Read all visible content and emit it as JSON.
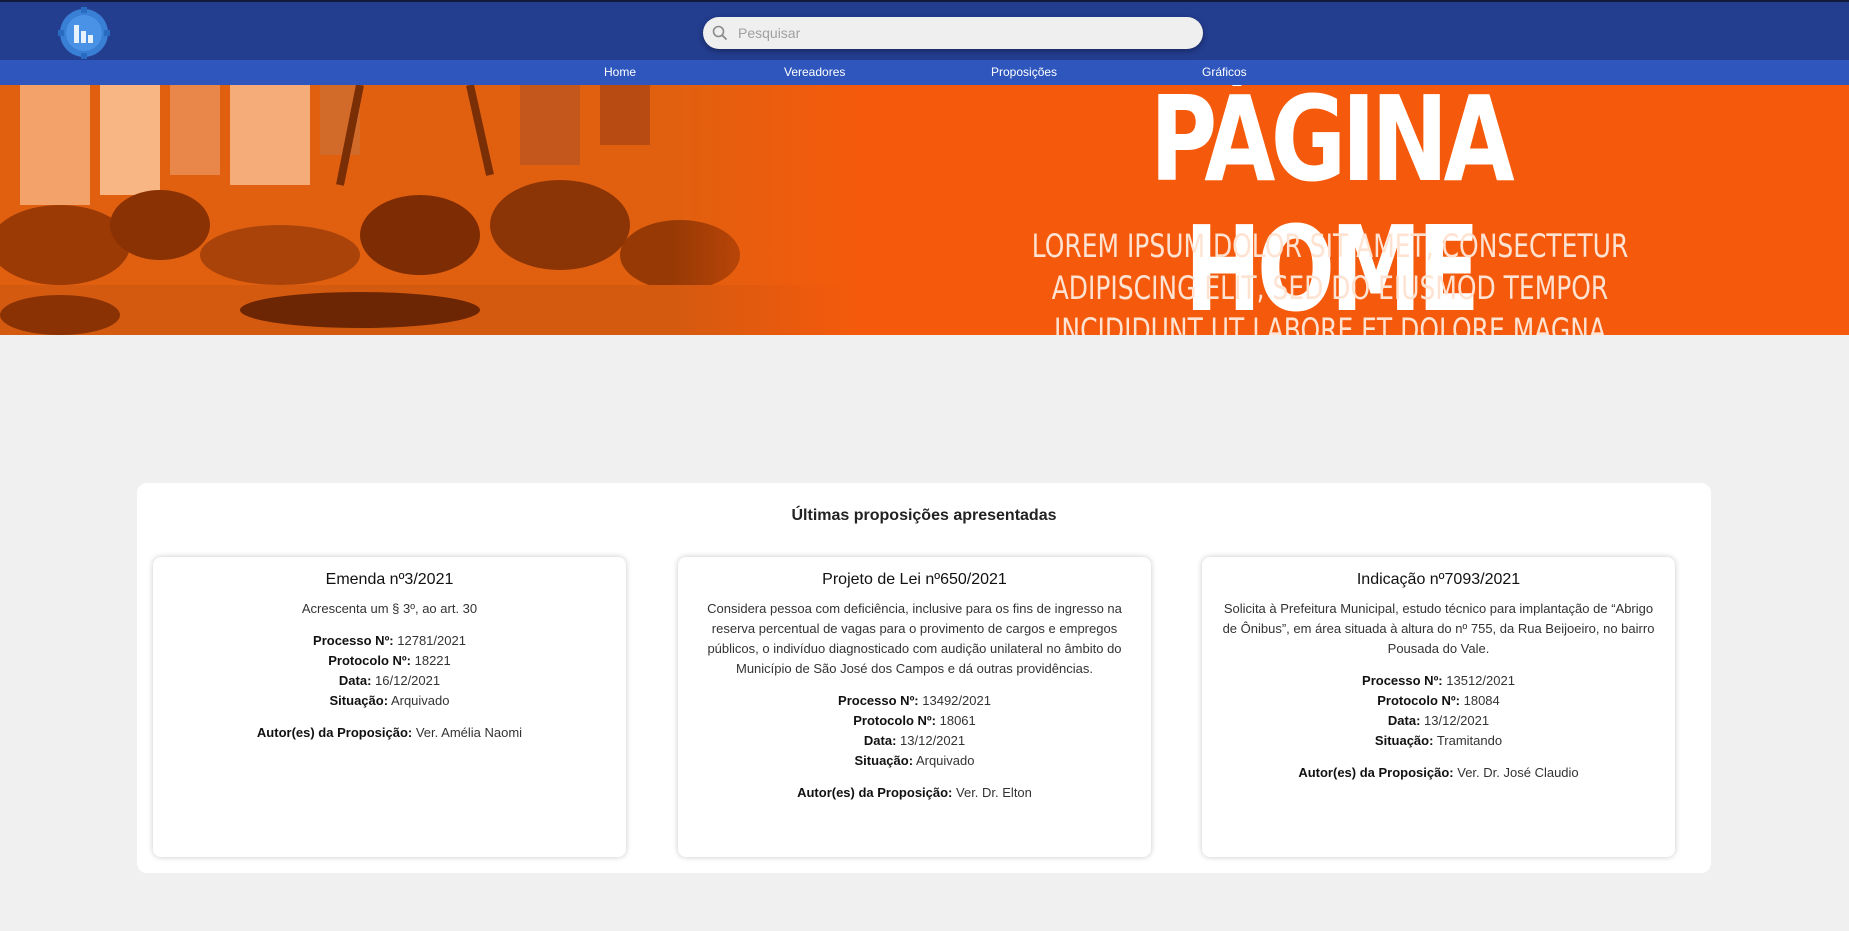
{
  "search": {
    "placeholder": "Pesquisar"
  },
  "nav": {
    "items": [
      "Home",
      "Vereadores",
      "Proposições",
      "Gráficos"
    ]
  },
  "hero": {
    "title": "PÁGINA HOME",
    "subtitle": "LOREM IPSUM DOLOR SIT AMET, CONSECTETUR ADIPISCING ELIT, SED DO EIUSMOD TEMPOR INCIDIDUNT UT LABORE ET DOLORE MAGNA ALIQUA. QUIS IPSUM SUSPENDISSE ULTRICES GRAVIDA"
  },
  "latest": {
    "title": "Últimas proposições apresentadas",
    "labels": {
      "processo": "Processo Nº:",
      "protocolo": "Protocolo Nº:",
      "data": "Data:",
      "situacao": "Situação:",
      "autor": "Autor(es) da Proposição:"
    },
    "cards": [
      {
        "title": "Emenda nº3/2021",
        "description": "Acrescenta um § 3º, ao art. 30",
        "processo": "12781/2021",
        "protocolo": "18221",
        "data": "16/12/2021",
        "situacao": "Arquivado",
        "autor": "Ver. Amélia Naomi"
      },
      {
        "title": "Projeto de Lei nº650/2021",
        "description": "Considera pessoa com deficiência, inclusive para os fins de ingresso na reserva percentual de vagas para o provimento de cargos e empregos públicos, o indivíduo diagnosticado com audição unilateral no âmbito do Município de São José dos Campos e dá outras providências.",
        "processo": "13492/2021",
        "protocolo": "18061",
        "data": "13/12/2021",
        "situacao": "Arquivado",
        "autor": "Ver. Dr. Elton"
      },
      {
        "title": "Indicação nº7093/2021",
        "description": "Solicita à Prefeitura Municipal, estudo técnico para implantação de “Abrigo de Ônibus”, em área situada à altura do nº 755, da Rua Beijoeiro, no bairro Pousada do Vale.",
        "processo": "13512/2021",
        "protocolo": "18084",
        "data": "13/12/2021",
        "situacao": "Tramitando",
        "autor": "Ver. Dr. José Claudio"
      }
    ]
  },
  "colors": {
    "topbar": "#233d8f",
    "nav": "#2e56bd",
    "hero": "#f55a0c",
    "background": "#f0f0f0"
  },
  "icons": {
    "logo": "logo-gear-chart-icon",
    "search": "search-icon"
  }
}
